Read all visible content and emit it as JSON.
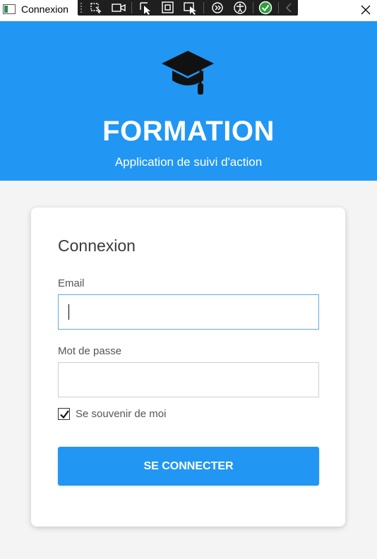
{
  "window": {
    "title": "Connexion",
    "icon": "app-window-icon",
    "close_icon": "close-icon"
  },
  "debug_toolbar": {
    "tools": [
      "select-element-icon",
      "video-capture-icon",
      "cursor-select-icon",
      "box-select-icon",
      "track-focus-icon",
      "hot-reload-icon",
      "accessibility-icon",
      "binding-check-icon",
      "collapse-arrow-icon"
    ],
    "status_color": "#2e9e3e"
  },
  "header": {
    "logo_icon": "graduation-cap-icon",
    "app_name": "FORMATION",
    "subtitle": "Application de suivi d'action",
    "background": "#2196f3"
  },
  "login_card": {
    "title": "Connexion",
    "email": {
      "label": "Email",
      "value": "",
      "placeholder": ""
    },
    "password": {
      "label": "Mot de passe",
      "value": "",
      "placeholder": ""
    },
    "remember_me": {
      "label": "Se souvenir de moi",
      "checked": true
    },
    "submit_label": "SE CONNECTER"
  },
  "colors": {
    "accent": "#2196f3",
    "page_background": "#f4f4f4",
    "focus_border": "#64a9e6"
  }
}
